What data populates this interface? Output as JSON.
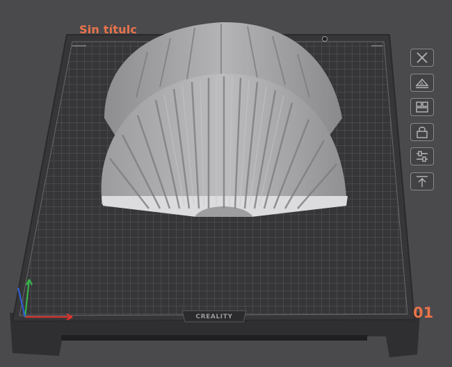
{
  "plate": {
    "title": "Sin títulc",
    "number": "01",
    "brand": "CREALITY"
  },
  "toolbar": {
    "buttons": [
      {
        "icon": "close-x-icon"
      },
      {
        "icon": "auto-orient-icon"
      },
      {
        "icon": "arrange-icon"
      },
      {
        "icon": "lock-icon"
      },
      {
        "icon": "plate-settings-icon"
      },
      {
        "icon": "move-to-top-icon"
      }
    ]
  },
  "colors": {
    "background": "#4a4a4d",
    "plate": "#3a3a3c",
    "grid": "#5c5c60",
    "accent": "#e9734a",
    "model": "#a9a9ab",
    "axis_x": "#d9342b",
    "axis_y": "#38b34a",
    "axis_z": "#2f5fd8"
  }
}
